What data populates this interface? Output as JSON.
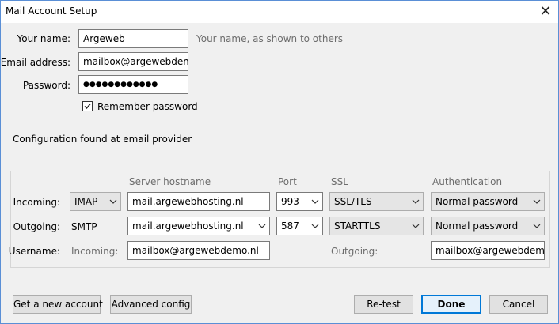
{
  "window": {
    "title": "Mail Account Setup"
  },
  "form": {
    "name_label": "Your name:",
    "name_label_u": "n",
    "name_value": "Argeweb",
    "name_hint": "Your name, as shown to others",
    "email_label": "Email address:",
    "email_value": "mailbox@argewebdemo",
    "password_label": "Password:",
    "password_value": "●●●●●●●●●●●●",
    "remember_label": "Remember password",
    "remember_checked": true
  },
  "status": {
    "text": "Configuration found at email provider"
  },
  "config": {
    "headers": {
      "server": "Server hostname",
      "port": "Port",
      "ssl": "SSL",
      "auth": "Authentication"
    },
    "incoming": {
      "label": "Incoming:",
      "protocol": "IMAP",
      "hostname": "mail.argewebhosting.nl",
      "port": "993",
      "ssl": "SSL/TLS",
      "auth": "Normal password"
    },
    "outgoing": {
      "label": "Outgoing:",
      "protocol": "SMTP",
      "hostname": "mail.argewebhosting.nl",
      "port": "587",
      "ssl": "STARTTLS",
      "auth": "Normal password"
    },
    "username": {
      "label": "Username:",
      "incoming_label": "Incoming:",
      "incoming_value": "mailbox@argewebdemo.nl",
      "outgoing_label": "Outgoing:",
      "outgoing_value": "mailbox@argewebdemo.nl"
    }
  },
  "buttons": {
    "get_account": "Get a new account",
    "advanced": "Advanced config",
    "retest": "Re-test",
    "done": "Done",
    "cancel": "Cancel"
  },
  "icons": {
    "close": "close-icon",
    "chevron": "chevron-down-icon",
    "check": "checkmark-icon"
  }
}
